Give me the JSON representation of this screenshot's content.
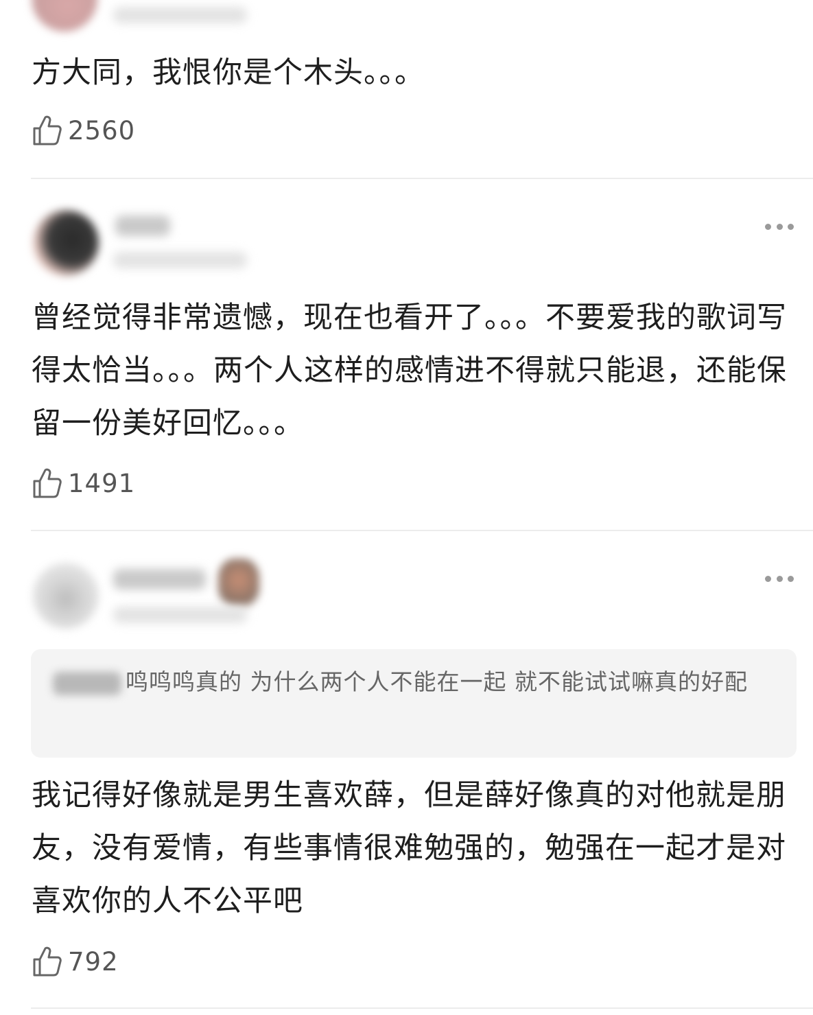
{
  "comments": [
    {
      "content": "方大同，我恨你是个木头。。。",
      "likes": "2560"
    },
    {
      "content": "曾经觉得非常遗憾，现在也看开了。。。不要爱我的歌词写得太恰当。。。两个人这样的感情进不得就只能退，还能保留一份美好回忆。。。",
      "likes": "1491"
    },
    {
      "quote": "鸣鸣鸣真的 为什么两个人不能在一起 就不能试试嘛真的好配",
      "content": "我记得好像就是男生喜欢薛，但是薛好像真的对他就是朋友，没有爱情，有些事情很难勉强的，勉强在一起才是对喜欢你的人不公平吧",
      "likes": "792"
    }
  ],
  "icons": {
    "like": "thumbs-up-icon",
    "more": "more-dots-icon"
  },
  "colors": {
    "text": "#1e1e1e",
    "secondary_text": "#555555",
    "quote_background": "#f4f4f4",
    "divider": "#ececec"
  }
}
